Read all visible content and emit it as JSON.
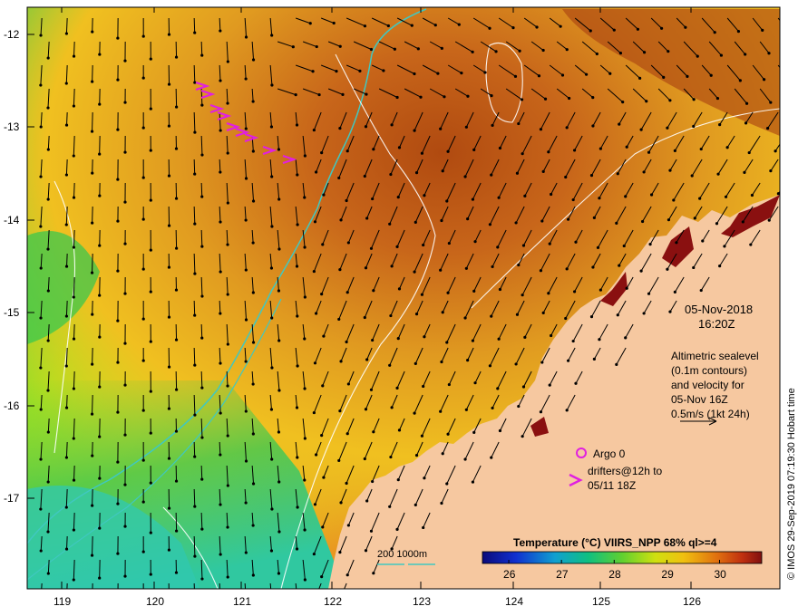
{
  "map": {
    "lon_labels": [
      "119",
      "120",
      "121",
      "122",
      "123",
      "124",
      "125",
      "126"
    ],
    "lat_labels": [
      "-12",
      "-13",
      "-14",
      "-15",
      "-16",
      "-17"
    ]
  },
  "info": {
    "date": "05-Nov-2018",
    "time": "16:20Z",
    "altimetry_lines": [
      "Altimetric sealevel",
      "(0.1m contours)",
      "and velocity for",
      "05-Nov 16Z",
      "0.5m/s (1kt 24h)"
    ]
  },
  "legend": {
    "argo_label": "Argo 0",
    "drifters_line1": "drifters@12h to",
    "drifters_line2": "05/11 18Z",
    "isobath_label": "200  1000m",
    "colorbar_title": "Temperature (°C) VIIRS_NPP 68% ql>=4",
    "colorbar_ticks": [
      "26",
      "27",
      "28",
      "29",
      "30"
    ],
    "colorbar_range": [
      25.5,
      30.8
    ]
  },
  "credit": "© IMOS 29-Sep-2019 07:19:30 Hobart time",
  "colors": {
    "land": "#f6c8a0",
    "drifter": "#e020e0",
    "isobath": "#40c8c0",
    "contour": "#ffffff"
  }
}
